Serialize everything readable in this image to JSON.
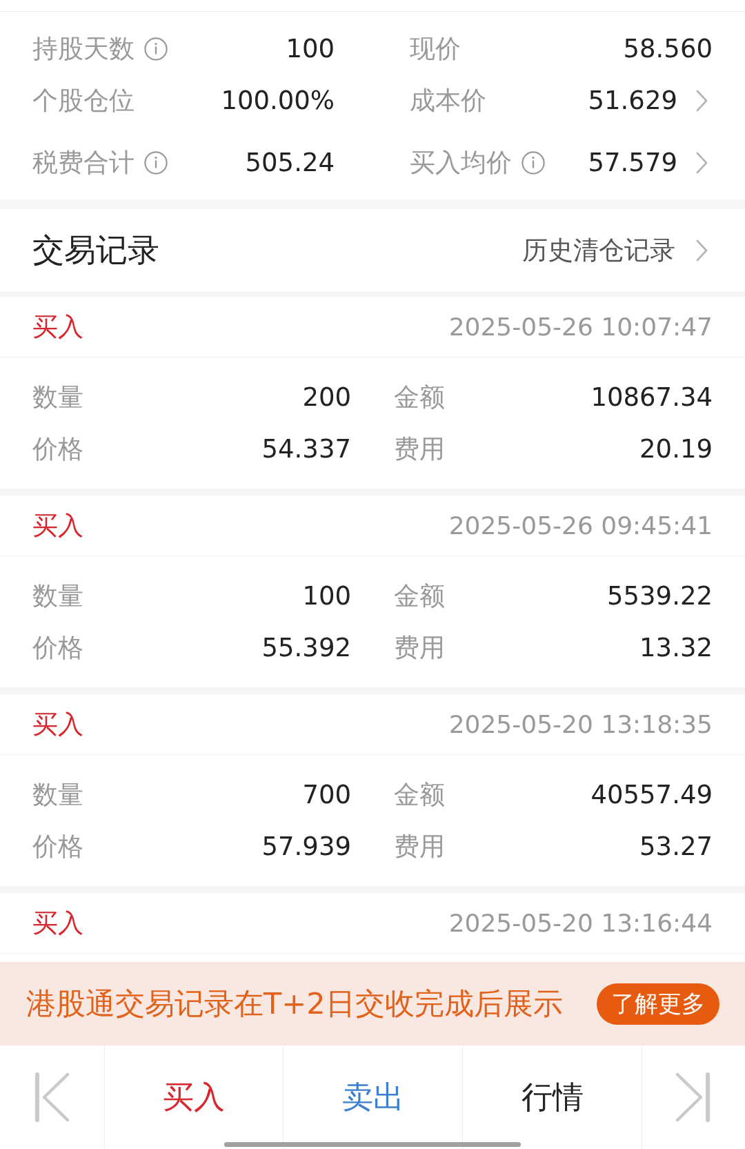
{
  "summary": [
    {
      "label": "持股天数",
      "info": true,
      "value": "100",
      "more": false
    },
    {
      "label": "现价",
      "info": false,
      "value": "58.560",
      "more": false
    },
    {
      "label": "个股仓位",
      "info": false,
      "value": "100.00%",
      "more": false
    },
    {
      "label": "成本价",
      "info": false,
      "value": "51.629",
      "more": true
    },
    {
      "label": "税费合计",
      "info": true,
      "value": "505.24",
      "more": false
    },
    {
      "label": "买入均价",
      "info": true,
      "value": "57.579",
      "more": true
    }
  ],
  "section": {
    "title": "交易记录",
    "link": "历史清仓记录"
  },
  "records": [
    {
      "kind": "buy",
      "type": "买入",
      "time": "2025-05-26 10:07:47",
      "fields": [
        {
          "label": "数量",
          "value": "200"
        },
        {
          "label": "金额",
          "value": "10867.34"
        },
        {
          "label": "价格",
          "value": "54.337"
        },
        {
          "label": "费用",
          "value": "20.19"
        }
      ]
    },
    {
      "kind": "buy",
      "type": "买入",
      "time": "2025-05-26 09:45:41",
      "fields": [
        {
          "label": "数量",
          "value": "100"
        },
        {
          "label": "金额",
          "value": "5539.22"
        },
        {
          "label": "价格",
          "value": "55.392"
        },
        {
          "label": "费用",
          "value": "13.32"
        }
      ]
    },
    {
      "kind": "buy",
      "type": "买入",
      "time": "2025-05-20 13:18:35",
      "fields": [
        {
          "label": "数量",
          "value": "700"
        },
        {
          "label": "金额",
          "value": "40557.49"
        },
        {
          "label": "价格",
          "value": "57.939"
        },
        {
          "label": "费用",
          "value": "53.27"
        }
      ]
    },
    {
      "kind": "buy",
      "type": "买入",
      "time": "2025-05-20 13:16:44"
    }
  ],
  "notice": {
    "text": "港股通交易记录在T+2日交收完成后展示",
    "button": "了解更多"
  },
  "toolbar": [
    {
      "kind": "buy",
      "label": "买入"
    },
    {
      "kind": "sell",
      "label": "卖出"
    },
    {
      "kind": "quote",
      "label": "行情"
    }
  ]
}
